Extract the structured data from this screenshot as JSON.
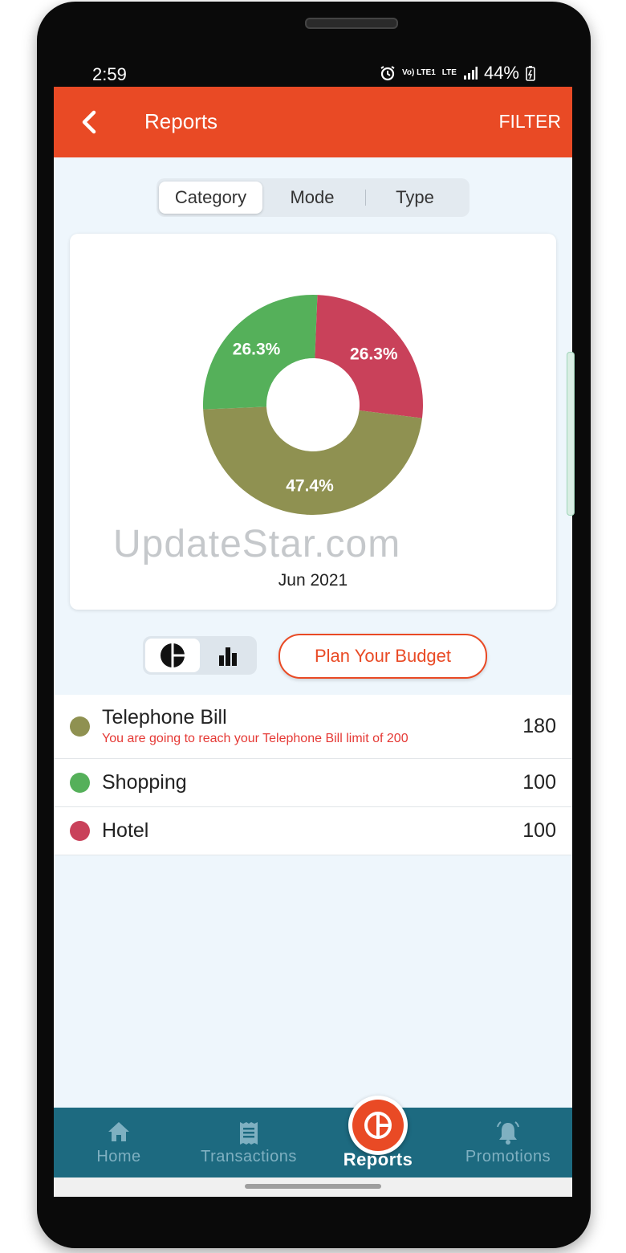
{
  "status": {
    "time": "2:59",
    "network": "Vo) LTE1",
    "lte": "LTE",
    "battery": "44%"
  },
  "appbar": {
    "title": "Reports",
    "filter": "FILTER"
  },
  "tabs": [
    {
      "label": "Category",
      "active": true
    },
    {
      "label": "Mode",
      "active": false
    },
    {
      "label": "Type",
      "active": false
    }
  ],
  "chart_data": {
    "type": "pie",
    "categories": [
      "Hotel",
      "Telephone Bill",
      "Shopping"
    ],
    "values": [
      26.3,
      47.4,
      26.3
    ],
    "labels": [
      "26.3%",
      "47.4%",
      "26.3%"
    ],
    "colors": [
      "#c9415a",
      "#8f9151",
      "#55b05a"
    ],
    "donut": true,
    "period": "Jun 2021"
  },
  "watermark": "UpdateStar.com",
  "budget_button": "Plan Your Budget",
  "list": [
    {
      "name": "Telephone Bill",
      "amount": "180",
      "color": "#8f9151",
      "warning": "You are going to reach your Telephone Bill limit of 200"
    },
    {
      "name": "Shopping",
      "amount": "100",
      "color": "#55b05a"
    },
    {
      "name": "Hotel",
      "amount": "100",
      "color": "#c9415a"
    }
  ],
  "nav": {
    "home": "Home",
    "transactions": "Transactions",
    "reports": "Reports",
    "promotions": "Promotions"
  }
}
